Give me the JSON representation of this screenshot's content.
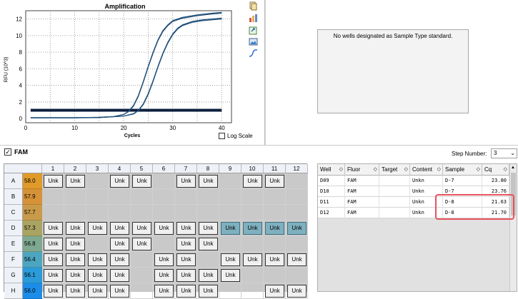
{
  "chart": {
    "title": "Amplification",
    "ylabel": "RFU (10^3)",
    "xlabel": "Cycles",
    "log_scale_label": "Log Scale",
    "y_ticks": [
      "0",
      "2",
      "4",
      "6",
      "8",
      "10",
      "12"
    ],
    "x_ticks": [
      "0",
      "10",
      "20",
      "30",
      "40"
    ]
  },
  "chart_data": {
    "type": "line",
    "title": "Amplification",
    "xlabel": "Cycles",
    "ylabel": "RFU (10^3)",
    "xlim": [
      0,
      42
    ],
    "ylim": [
      -0.5,
      13
    ],
    "grid": true,
    "threshold": 1.0,
    "threshold_color": "#0d1f3d",
    "series_color": "#1f4e79",
    "series": [
      {
        "x": [
          1,
          5,
          10,
          15,
          18,
          20,
          21,
          22,
          23,
          24,
          25,
          26,
          27,
          28,
          29,
          30,
          32,
          35,
          38,
          40
        ],
        "values": [
          0.1,
          0.1,
          0.1,
          0.15,
          0.25,
          0.5,
          0.9,
          1.6,
          2.8,
          4.5,
          6.3,
          8.0,
          9.5,
          10.6,
          11.3,
          11.8,
          12.2,
          12.5,
          12.7,
          12.8
        ]
      },
      {
        "x": [
          1,
          5,
          10,
          15,
          18,
          20,
          21,
          22,
          23,
          24,
          25,
          26,
          27,
          28,
          29,
          30,
          32,
          35,
          38,
          40
        ],
        "values": [
          0.1,
          0.1,
          0.1,
          0.15,
          0.25,
          0.5,
          0.85,
          1.5,
          2.7,
          4.4,
          6.2,
          7.9,
          9.4,
          10.5,
          11.2,
          11.7,
          12.1,
          12.4,
          12.6,
          12.7
        ]
      },
      {
        "x": [
          1,
          5,
          10,
          15,
          20,
          22,
          23,
          24,
          25,
          26,
          27,
          28,
          29,
          30,
          31,
          32,
          34,
          36,
          38,
          40
        ],
        "values": [
          0.1,
          0.1,
          0.1,
          0.12,
          0.3,
          0.6,
          1.0,
          1.8,
          3.0,
          4.6,
          6.3,
          7.9,
          9.2,
          10.2,
          10.9,
          11.3,
          11.7,
          11.9,
          12.0,
          12.1
        ]
      },
      {
        "x": [
          1,
          5,
          10,
          15,
          20,
          22,
          23,
          24,
          25,
          26,
          27,
          28,
          29,
          30,
          31,
          32,
          34,
          36,
          38,
          40
        ],
        "values": [
          0.1,
          0.1,
          0.1,
          0.12,
          0.3,
          0.55,
          0.95,
          1.7,
          2.9,
          4.5,
          6.2,
          7.8,
          9.1,
          10.1,
          10.8,
          11.2,
          11.6,
          11.8,
          11.9,
          12.0
        ]
      }
    ]
  },
  "toolbar_icons": [
    "copy-icon",
    "chart-settings-icon",
    "export-icon",
    "image-export-icon",
    "curve-icon"
  ],
  "std_curve": {
    "message": "No wells designated as Sample Type standard."
  },
  "fluor": {
    "name": "FAM",
    "checked": true
  },
  "step": {
    "label": "Step Number:",
    "value": "3"
  },
  "plate": {
    "columns": [
      "1",
      "2",
      "3",
      "4",
      "5",
      "6",
      "7",
      "8",
      "9",
      "10",
      "11",
      "12"
    ],
    "rows": [
      {
        "label": "A",
        "temp": "58.0",
        "temp_color": "#e09a2a",
        "wells": [
          "Unk",
          "Unk",
          "",
          "Unk",
          "Unk",
          "",
          "Unk",
          "Unk",
          "",
          "Unk",
          "Unk",
          ""
        ]
      },
      {
        "label": "B",
        "temp": "57.9",
        "temp_color": "#d59238",
        "wells": [
          "",
          "",
          "",
          "",
          "",
          "",
          "",
          "",
          "",
          "",
          "",
          ""
        ]
      },
      {
        "label": "C",
        "temp": "57.7",
        "temp_color": "#c99a4a",
        "wells": [
          "",
          "",
          "",
          "",
          "",
          "",
          "",
          "",
          "",
          "",
          "",
          ""
        ]
      },
      {
        "label": "D",
        "temp": "57.3",
        "temp_color": "#a9a461",
        "wells": [
          "Unk",
          "Unk",
          "Unk",
          "Unk",
          "Unk",
          "Unk",
          "Unk",
          "Unk",
          "Unk*",
          "Unk*",
          "Unk*",
          "Unk*"
        ]
      },
      {
        "label": "E",
        "temp": "56.8",
        "temp_color": "#7ea88f",
        "wells": [
          "Unk",
          "Unk",
          "",
          "Unk",
          "Unk",
          "",
          "Unk",
          "Unk",
          "",
          "",
          "",
          ""
        ]
      },
      {
        "label": "F",
        "temp": "56.4",
        "temp_color": "#4da6c0",
        "wells": [
          "Unk",
          "Unk",
          "Unk",
          "Unk",
          "",
          "Unk",
          "Unk",
          "",
          "Unk",
          "Unk",
          "Unk",
          "Unk"
        ]
      },
      {
        "label": "G",
        "temp": "56.1",
        "temp_color": "#2b9ad8",
        "wells": [
          "Unk",
          "Unk",
          "Unk",
          "Unk",
          "",
          "Unk",
          "Unk",
          "Unk",
          "Unk",
          "",
          "",
          ""
        ]
      },
      {
        "label": "H",
        "temp": "56.0",
        "temp_color": "#1b8de8",
        "wells": [
          "Unk",
          "Unk",
          "Unk",
          "Unk",
          "",
          "Unk",
          "Unk",
          "Unk",
          "",
          "",
          "Unk",
          "Unk"
        ]
      }
    ]
  },
  "results": {
    "headers": [
      "Well",
      "Fluor",
      "Target",
      "Content",
      "Sample",
      "Cq"
    ],
    "rows": [
      {
        "well": "D09",
        "fluor": "FAM",
        "target": "",
        "content": "Unkn",
        "sample": "D-7",
        "cq": "23.80"
      },
      {
        "well": "D10",
        "fluor": "FAM",
        "target": "",
        "content": "Unkn",
        "sample": "D-7",
        "cq": "23.76"
      },
      {
        "well": "D11",
        "fluor": "FAM",
        "target": "",
        "content": "Unkn",
        "sample": "D-8",
        "cq": "21.63"
      },
      {
        "well": "D12",
        "fluor": "FAM",
        "target": "",
        "content": "Unkn",
        "sample": "D-8",
        "cq": "21.70"
      }
    ]
  }
}
